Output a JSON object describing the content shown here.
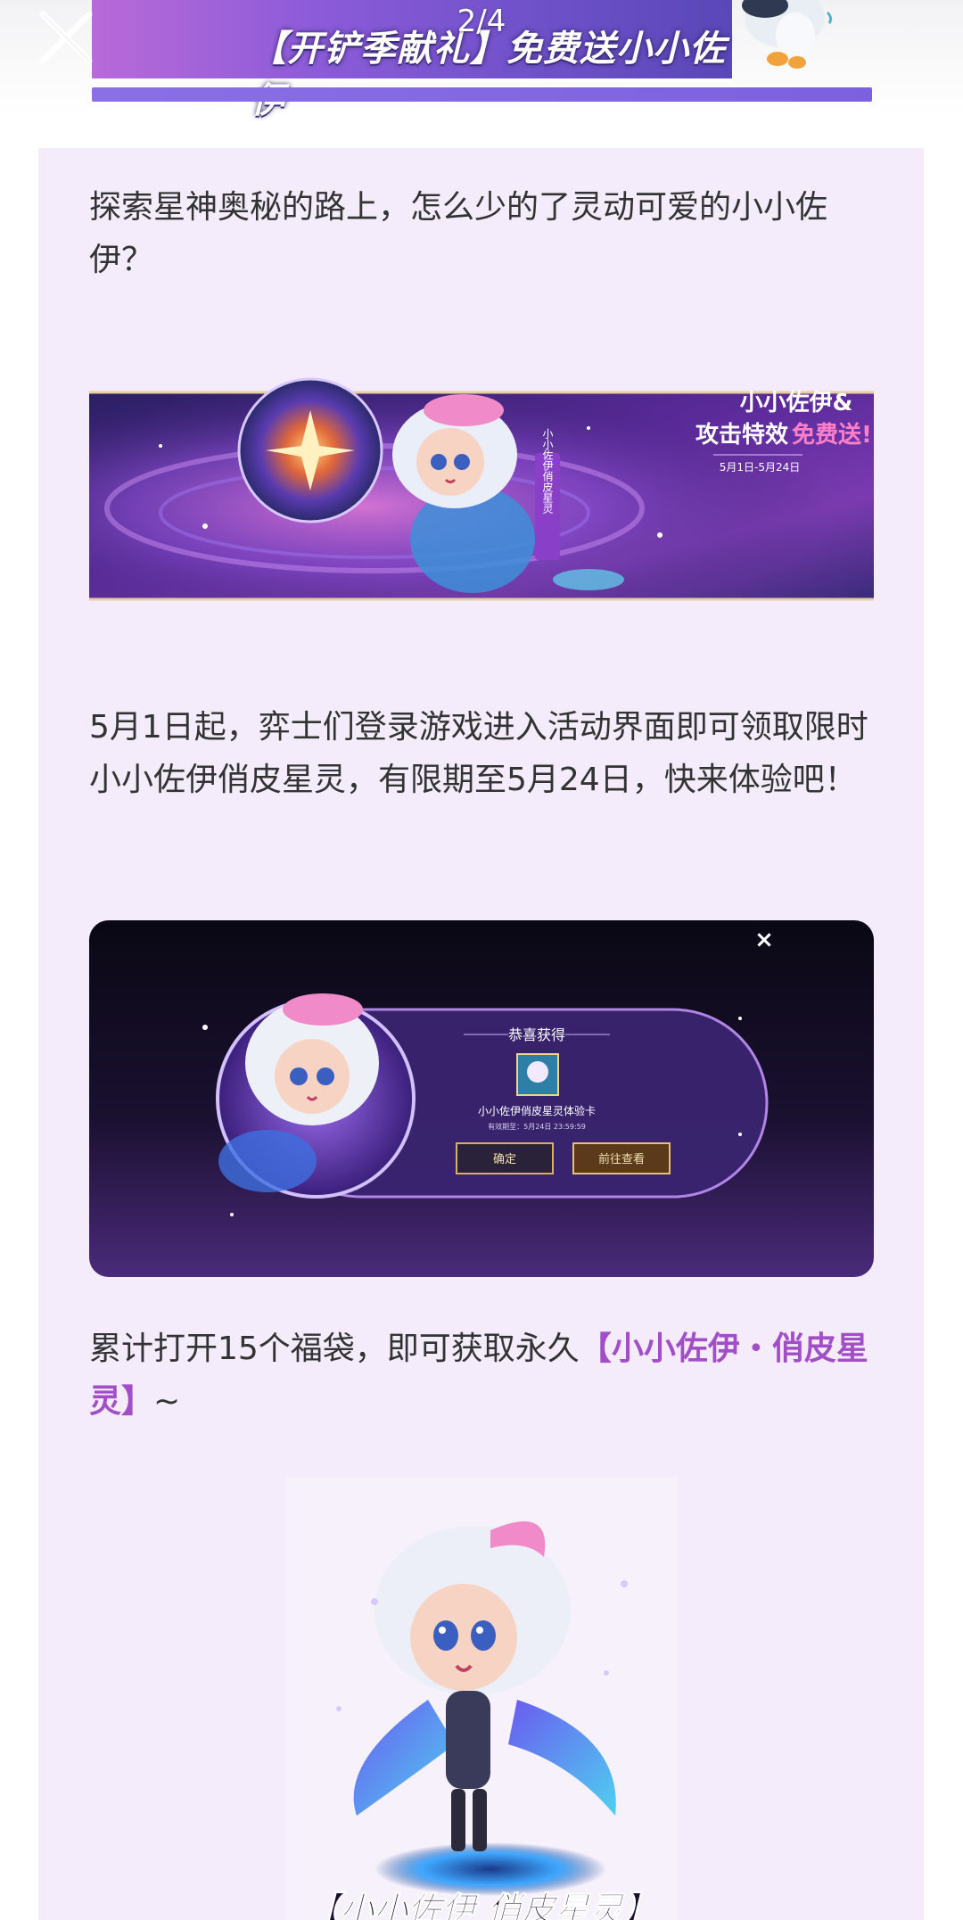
{
  "header": {
    "banner_title": "【开铲季献礼】免费送小小佐伊",
    "page_counter": "2/4"
  },
  "article": {
    "paragraph_1": "探索星神奥秘的路上，怎么少的了灵动可爱的小小佐伊？",
    "banner_image": {
      "headline_line1": "小小佐伊&",
      "headline_line2_prefix": "攻击特效",
      "headline_line2_highlight": "免费送!",
      "date_range": "5月1日-5月24日",
      "vertical_tag": "小小佐伊俏皮星灵"
    },
    "paragraph_2": "5月1日起，弈士们登录游戏进入活动界面即可领取限时小小佐伊俏皮星灵，有限期至5月24日，快来体验吧！",
    "popup_image": {
      "close_glyph": "×",
      "congrats_title": "恭喜获得",
      "item_name": "小小佐伊俏皮星灵体验卡",
      "validity": "有效期至：5月24日 23:59:59",
      "confirm_label": "确定",
      "view_label": "前往查看"
    },
    "paragraph_3_prefix": "累计打开15个福袋，即可获取永久",
    "paragraph_3_highlight": "【小小佐伊・俏皮星灵】",
    "paragraph_3_suffix": "~",
    "chibi_image": {
      "caption": "【小小佐伊 俏皮星灵】"
    }
  },
  "colors": {
    "card_background": "#f4ecfb",
    "highlight": "#a24fc7",
    "body_text": "#333333"
  },
  "icons": [
    "close-icon"
  ]
}
